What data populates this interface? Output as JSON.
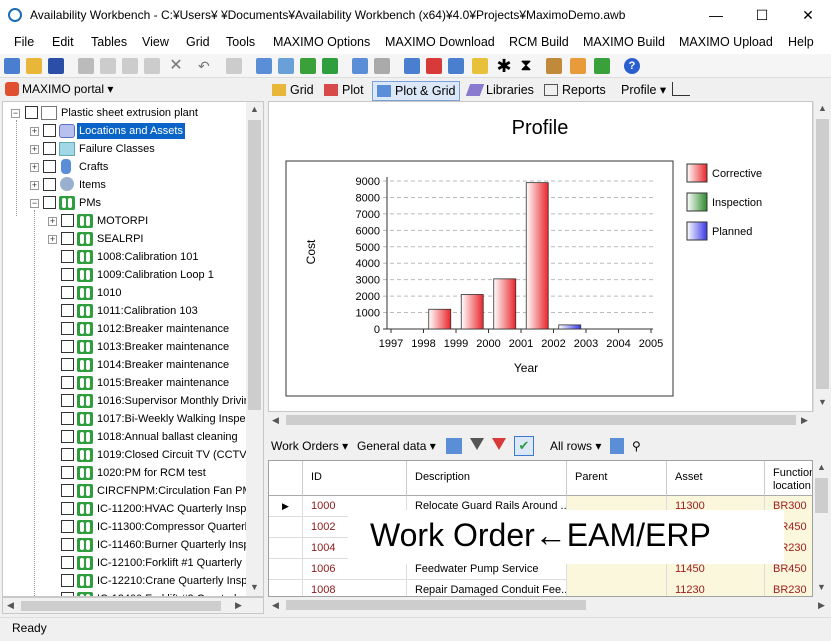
{
  "window": {
    "title": "Availability Workbench - C:¥Users¥                    ¥Documents¥Availability Workbench (x64)¥4.0¥Projects¥MaximoDemo.awb",
    "minimize": "—",
    "maximize": "☐",
    "close": "✕"
  },
  "menu": [
    "File",
    "Edit",
    "Tables",
    "View",
    "Grid",
    "Tools",
    "MAXIMO Options",
    "MAXIMO Download",
    "RCM Build",
    "MAXIMO Build",
    "MAXIMO Upload",
    "Help"
  ],
  "left_header": {
    "label": "MAXIMO portal ▾"
  },
  "tree": {
    "root": "Plastic sheet extrusion plant",
    "children": [
      {
        "label": "Locations and Assets",
        "selected": true
      },
      {
        "label": "Failure Classes"
      },
      {
        "label": "Crafts"
      },
      {
        "label": "Items"
      },
      {
        "label": "PMs"
      }
    ],
    "pms": [
      "MOTORPI",
      "SEALRPI",
      "1008:Calibration 101",
      "1009:Calibration Loop 1",
      "1010",
      "1011:Calibration 103",
      "1012:Breaker maintenance",
      "1013:Breaker maintenance",
      "1014:Breaker maintenance",
      "1015:Breaker maintenance",
      "1016:Supervisor Monthly Drivin",
      "1017:Bi-Weekly Walking Inspec",
      "1018:Annual ballast cleaning",
      "1019:Closed Circuit TV (CCTV)",
      "1020:PM for RCM test",
      "CIRCFNPM:Circulation Fan PM (",
      "IC-11200:HVAC Quarterly Insp",
      "IC-11300:Compressor Quarterl",
      "IC-11460:Burner Quarterly Insp",
      "IC-12100:Forklift #1 Quarterly In",
      "IC-12210:Crane Quarterly Inspe",
      "IC-12400:Forklift #2 Quarterly In"
    ]
  },
  "right_tabs": [
    "Grid",
    "Plot",
    "Plot & Grid",
    "Libraries",
    "Reports",
    "Profile ▾"
  ],
  "chart_data": {
    "type": "bar",
    "title": "Profile",
    "xlabel": "Year",
    "ylabel": "Cost",
    "categories": [
      "1997",
      "1998",
      "1999",
      "2000",
      "2001",
      "2002",
      "2003",
      "2004",
      "2005"
    ],
    "series": [
      {
        "name": "Corrective",
        "values": [
          0,
          1200,
          2100,
          3050,
          8900,
          0,
          0,
          0,
          0
        ],
        "color": "#e8262b"
      },
      {
        "name": "Inspection",
        "values": [
          0,
          0,
          0,
          0,
          0,
          0,
          0,
          0,
          0
        ],
        "color": "#2e8b2e"
      },
      {
        "name": "Planned",
        "values": [
          0,
          0,
          0,
          0,
          0,
          250,
          0,
          0,
          0
        ],
        "color": "#3a3ae8"
      }
    ],
    "yticks": [
      "9000",
      "8000",
      "7000",
      "6000",
      "5000",
      "4000",
      "3000",
      "2000",
      "1000",
      "0"
    ],
    "ylim": [
      0,
      9000
    ],
    "grid": true,
    "legend": "right"
  },
  "grid_toolbar": {
    "work_orders": "Work Orders ▾",
    "general_data": "General data ▾",
    "all_rows": "All rows ▾"
  },
  "grid": {
    "columns": [
      "ID",
      "Description",
      "Parent",
      "Asset",
      "Function location"
    ],
    "rows": [
      {
        "id": "1000",
        "desc": "Relocate Guard Rails Around ...",
        "parent": "",
        "asset": "11300",
        "loc": "BR300"
      },
      {
        "id": "1002",
        "desc": "",
        "parent": "",
        "asset": "",
        "loc": "BR450"
      },
      {
        "id": "1004",
        "desc": "",
        "parent": "",
        "asset": "",
        "loc": "BR230"
      },
      {
        "id": "1006",
        "desc": "Feedwater Pump Service",
        "parent": "",
        "asset": "11450",
        "loc": "BR450"
      },
      {
        "id": "1008",
        "desc": "Repair Damaged Conduit Fee...",
        "parent": "",
        "asset": "11230",
        "loc": "BR230"
      }
    ]
  },
  "overlay": {
    "text": "Work Order←EAM/ERP"
  },
  "status": {
    "text": "Ready"
  }
}
